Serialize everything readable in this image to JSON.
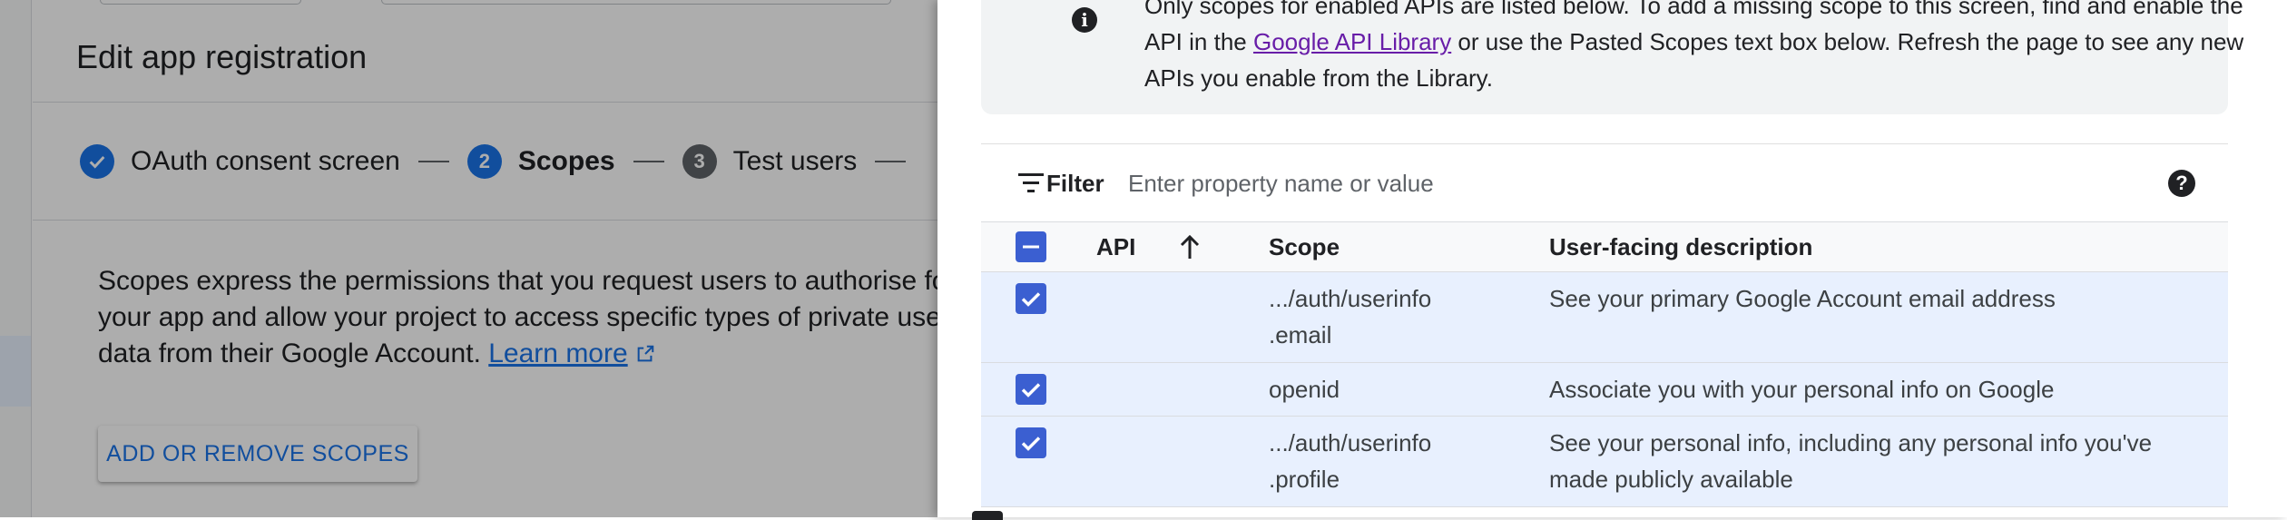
{
  "background": {
    "title": "Edit app registration",
    "steps": [
      {
        "number": "✓",
        "label": "OAuth consent screen",
        "state": "done",
        "color": "#1a73e8"
      },
      {
        "number": "2",
        "label": "Scopes",
        "state": "active",
        "color": "#1a73e8"
      },
      {
        "number": "3",
        "label": "Test users",
        "state": "pending",
        "color": "#5f6368"
      }
    ],
    "description": "Scopes express the permissions that you request users to authorise for your app and allow your project to access specific types of private user data from their Google Account.",
    "learn_more": "Learn more",
    "add_remove_button": "ADD OR REMOVE SCOPES"
  },
  "panel": {
    "info": {
      "icon": "info-icon",
      "text_before": "Only scopes for enabled APIs are listed below. To add a missing scope to this screen, find and enable the API in the ",
      "link": "Google API Library",
      "text_after": " or use the Pasted Scopes text box below. Refresh the page to see any new APIs you enable from the Library."
    },
    "filter": {
      "label": "Filter",
      "placeholder": "Enter property name or value",
      "help_icon": "help-icon"
    },
    "table": {
      "headers": {
        "api": "API",
        "scope": "Scope",
        "description": "User-facing description"
      },
      "sort": "ascending",
      "rows": [
        {
          "checked": true,
          "scope_line1": ".../auth/userinfo",
          "scope_line2": ".email",
          "description_line1": "See your primary Google Account email address",
          "description_line2": ""
        },
        {
          "checked": true,
          "scope_line1": "openid",
          "scope_line2": "",
          "description_line1": "Associate you with your personal info on Google",
          "description_line2": ""
        },
        {
          "checked": true,
          "scope_line1": ".../auth/userinfo",
          "scope_line2": ".profile",
          "description_line1": "See your personal info, including any personal info you've",
          "description_line2": "made publicly available"
        }
      ]
    }
  },
  "colors": {
    "accent": "#1a73e8",
    "checkbox": "#3b5fd1",
    "selected_row": "#e8f0fe",
    "link_visited": "#681da8"
  }
}
